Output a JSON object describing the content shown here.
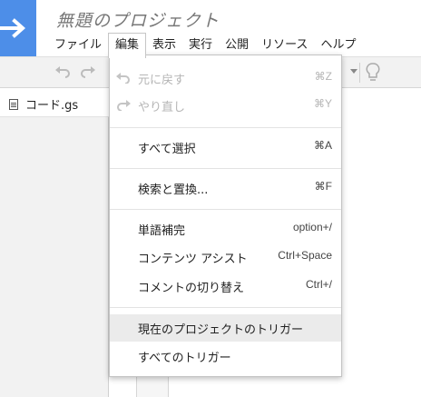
{
  "app": {
    "title": "無題のプロジェクト"
  },
  "menubar": {
    "items": [
      "ファイル",
      "編集",
      "表示",
      "実行",
      "公開",
      "リソース",
      "ヘルプ"
    ]
  },
  "files": [
    {
      "name": "コード.gs"
    }
  ],
  "edit_menu": {
    "undo": {
      "label": "元に戻す",
      "shortcut": "⌘Z"
    },
    "redo": {
      "label": "やり直し",
      "shortcut": "⌘Y"
    },
    "select_all": {
      "label": "すべて選択",
      "shortcut": "⌘A"
    },
    "find_replace": {
      "label": "検索と置換...",
      "shortcut": "⌘F"
    },
    "word_complete": {
      "label": "単語補完",
      "shortcut": "option+/"
    },
    "content_assist": {
      "label": "コンテンツ アシスト",
      "shortcut": "Ctrl+Space"
    },
    "toggle_comment": {
      "label": "コメントの切り替え",
      "shortcut": "Ctrl+/"
    },
    "current_triggers": {
      "label": "現在のプロジェクトのトリガー"
    },
    "all_triggers": {
      "label": "すべてのトリガー"
    }
  },
  "colors": {
    "brand": "#4d8ee8",
    "highlight": "#ebebeb",
    "disabled_text": "#b5b5b5"
  }
}
